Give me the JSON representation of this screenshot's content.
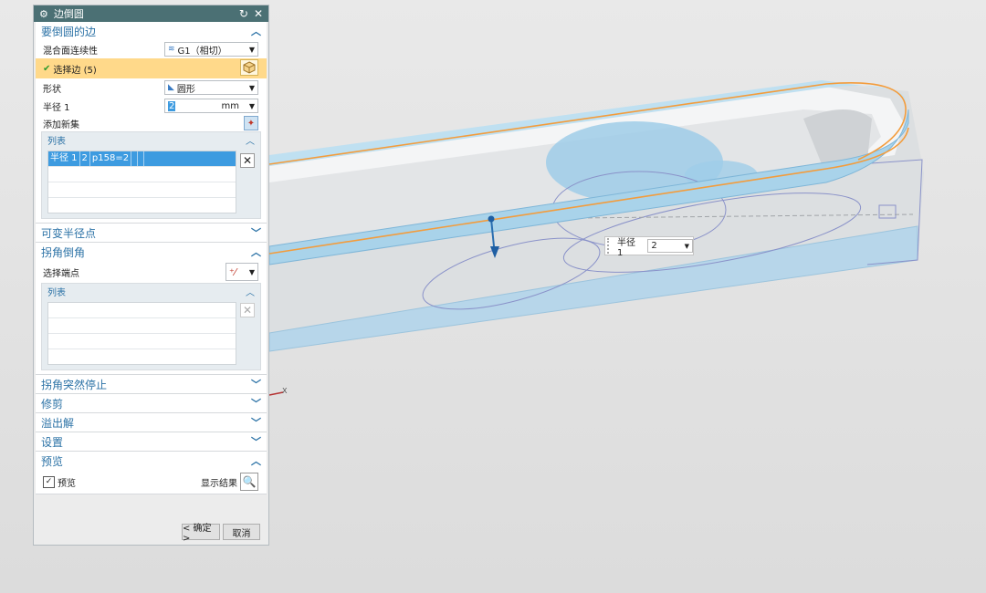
{
  "dialog": {
    "title": "边倒圆",
    "sections": {
      "edges": {
        "title": "要倒圆的边",
        "continuity_label": "混合面连续性",
        "continuity_value": "G1（相切）",
        "select_edge_label": "选择边 (5)",
        "shape_label": "形状",
        "shape_value": "圆形",
        "radius_label": "半径 1",
        "radius_value": "2",
        "radius_unit": "mm",
        "add_new_set_label": "添加新集",
        "list_title": "列表",
        "list_rows": [
          {
            "name": "半径 1",
            "value": "2",
            "expr": "p158=2"
          }
        ]
      },
      "variable_radius": {
        "title": "可变半径点"
      },
      "corner_setback": {
        "title": "拐角倒角",
        "select_endpoint_label": "选择端点",
        "list_title": "列表"
      },
      "stop_short": {
        "title": "拐角突然停止"
      },
      "trim": {
        "title": "修剪"
      },
      "overflow": {
        "title": "溢出解"
      },
      "settings": {
        "title": "设置"
      },
      "preview": {
        "title": "预览",
        "preview_checkbox_label": "预览",
        "preview_checked": true,
        "show_result_label": "显示结果"
      }
    },
    "ok_label": "< 确定 >",
    "cancel_label": "取消"
  },
  "viewport_tip": {
    "label": "半径 1",
    "value": "2"
  },
  "axis_label": "X",
  "colors": {
    "title_bar": "#4b7074",
    "section_header_text": "#2b72a6",
    "selected_edge_highlight": "#ffd98a",
    "selected_list_row": "#3d9be0",
    "edge_orange": "#f39c3c",
    "model_blue": "#8fc6e4"
  }
}
